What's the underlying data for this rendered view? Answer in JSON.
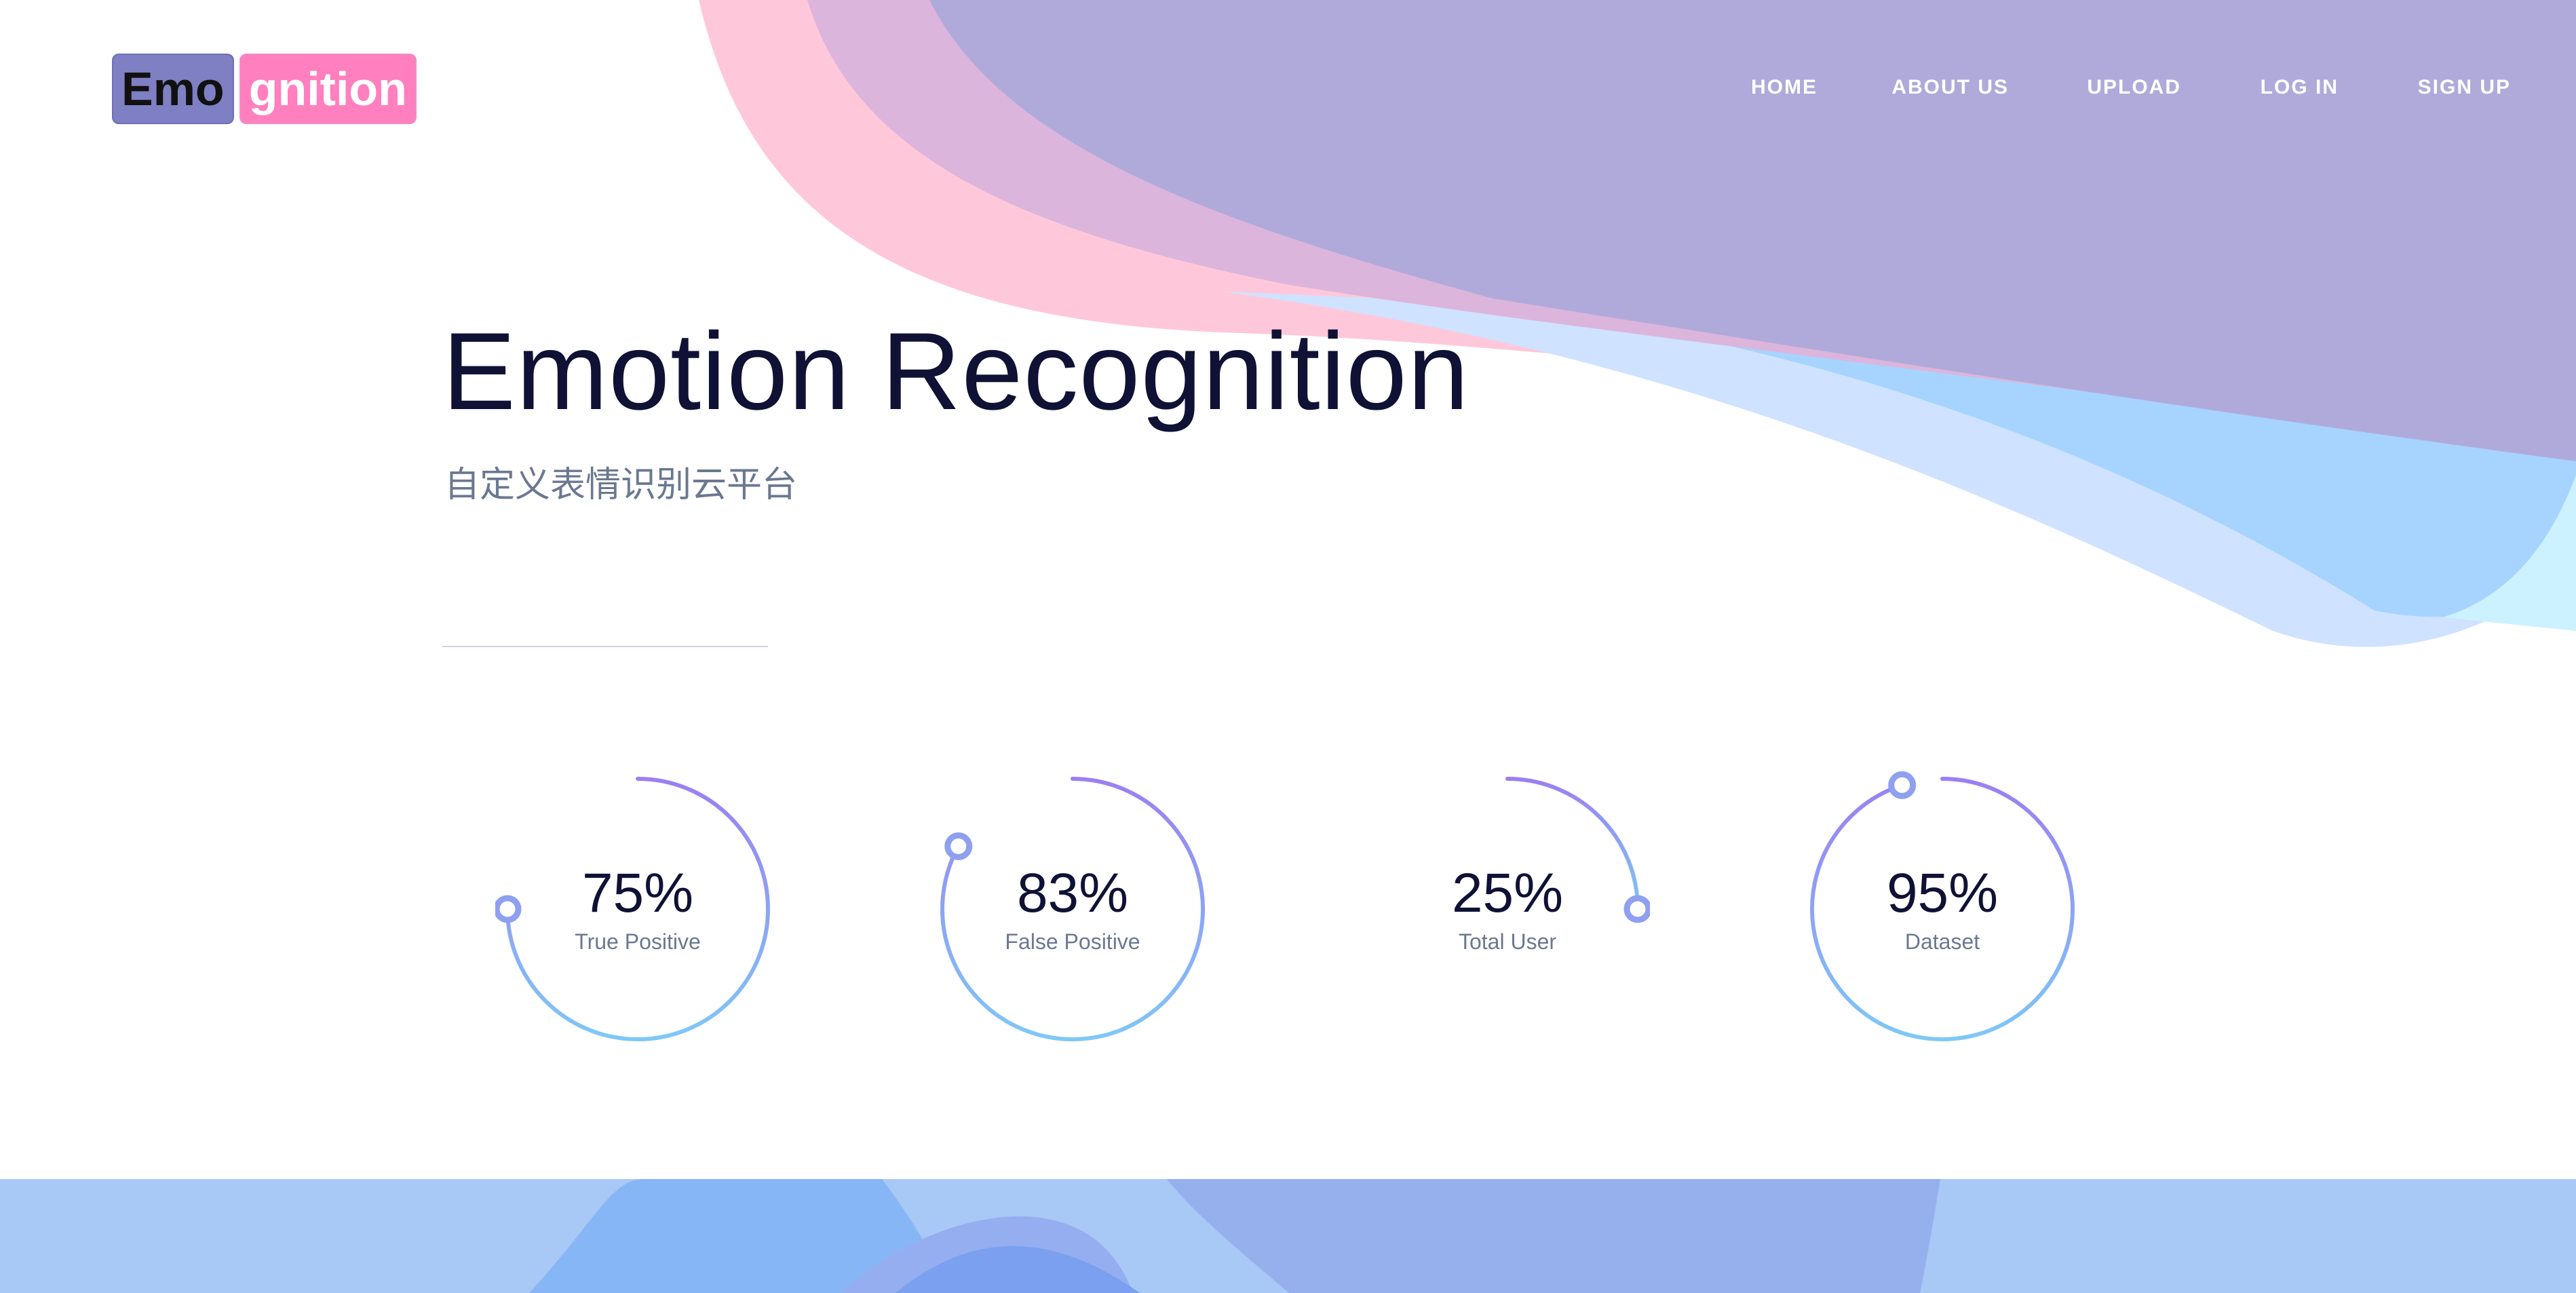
{
  "brand": {
    "part1": "Emo",
    "part2": "gnition"
  },
  "nav": {
    "items": [
      "HOME",
      "ABOUT US",
      "UPLOAD",
      "LOG IN",
      "SIGN UP"
    ]
  },
  "hero": {
    "title": "Emotion Recognition",
    "subtitle": "自定义表情识别云平台"
  },
  "stats": [
    {
      "value": "75%",
      "label": "True Positive",
      "fraction": 0.75
    },
    {
      "value": "83%",
      "label": "False Positive",
      "fraction": 0.83
    },
    {
      "value": "25%",
      "label": "Total User",
      "fraction": 0.25
    },
    {
      "value": "95%",
      "label": "Dataset",
      "fraction": 0.95
    }
  ],
  "colors": {
    "accent_purple": "#9b7ff2",
    "accent_blue": "#7fc8f6",
    "heading": "#0f1235",
    "muted": "#6b7890",
    "logo_left": "#7f7fc4",
    "logo_right": "#ff7fbf"
  }
}
